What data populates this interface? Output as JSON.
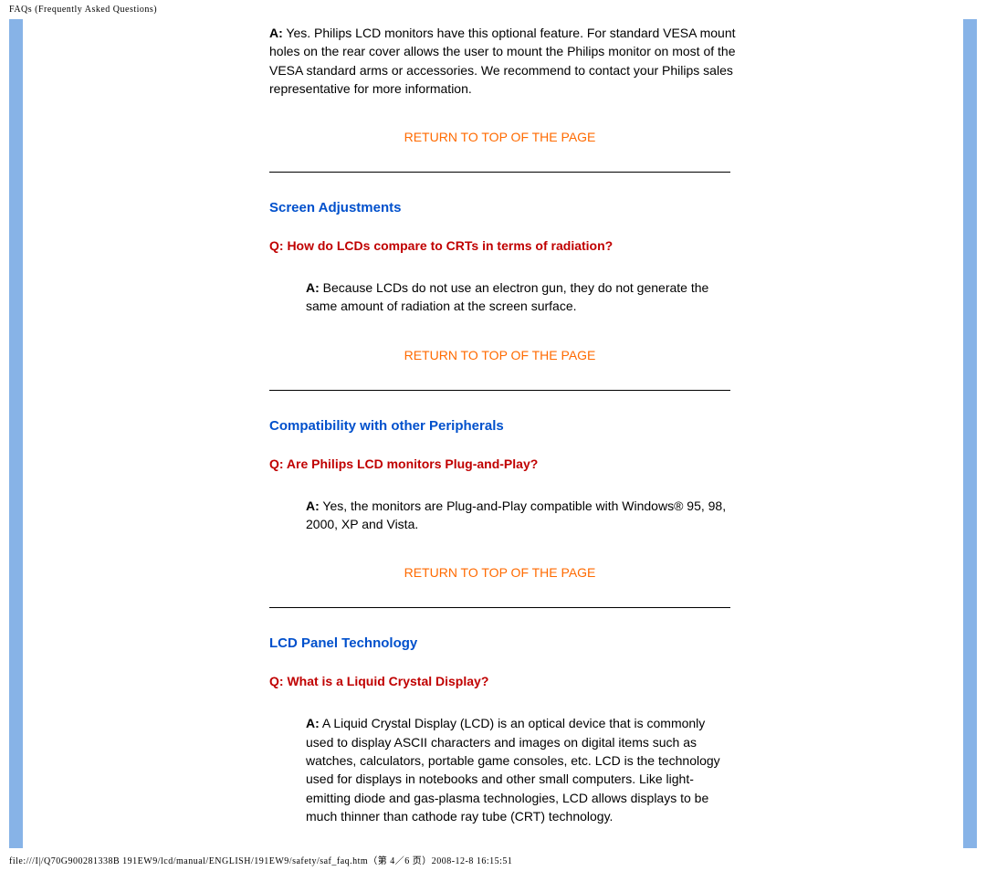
{
  "header_path": "FAQs (Frequently Asked Questions)",
  "footer_path": "file:///I|/Q70G900281338B 191EW9/lcd/manual/ENGLISH/191EW9/safety/saf_faq.htm（第 4／6 页）2008-12-8 16:15:51",
  "return_label": "RETURN TO TOP OF THE PAGE",
  "sections": {
    "intro_answer_prefix": "A:",
    "intro_answer": " Yes. Philips LCD monitors have this optional feature. For standard VESA mount holes on the rear cover allows the user to mount the Philips monitor on most of the VESA standard arms or accessories. We recommend to contact your Philips sales representative for more information.",
    "screen_adjustments": {
      "heading": "Screen Adjustments",
      "q": "Q: How do LCDs compare to CRTs in terms of radiation?",
      "a_prefix": "A:",
      "a": " Because LCDs do not use an electron gun, they do not generate the same amount of radiation at the screen surface."
    },
    "compat": {
      "heading": "Compatibility with other Peripherals",
      "q": "Q: Are Philips LCD monitors Plug-and-Play?",
      "a_prefix": "A:",
      "a": " Yes, the monitors are Plug-and-Play compatible with Windows® 95, 98, 2000, XP and Vista."
    },
    "lcd_panel": {
      "heading": "LCD Panel Technology",
      "q": "Q: What is a Liquid Crystal Display?",
      "a_prefix": "A:",
      "a": " A Liquid Crystal Display (LCD) is an optical device that is commonly used to display ASCII characters and images on digital items such as watches, calculators, portable game consoles, etc. LCD is the technology used for displays in notebooks and other small computers. Like light-emitting diode and gas-plasma technologies, LCD allows displays to be much thinner than cathode ray tube (CRT) technology."
    }
  }
}
